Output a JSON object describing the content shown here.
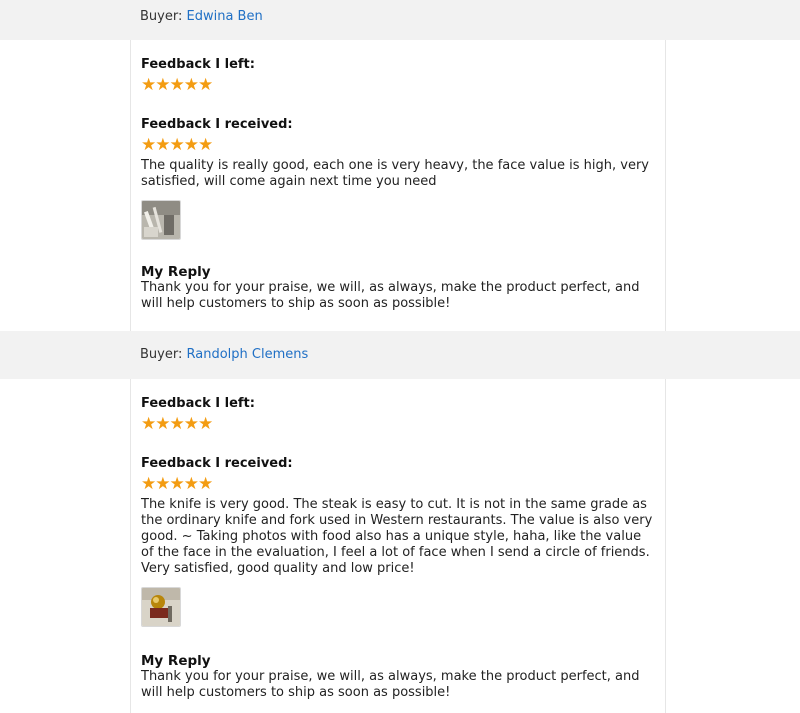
{
  "reviews": [
    {
      "buyer_label": "Buyer:",
      "buyer_name": "Edwina Ben",
      "feedback_left_label": "Feedback I left:",
      "feedback_left_stars": "★★★★★",
      "feedback_left_rating": 5,
      "feedback_received_label": "Feedback I received:",
      "feedback_received_stars": "★★★★★",
      "feedback_received_rating": 5,
      "comment": "The quality is really good, each one is very heavy, the face value is high, very satisfied, will come again next time you need",
      "photo_icon": "review-photo",
      "reply_label": "My Reply",
      "reply_text": "Thank you for your praise, we will, as always, make the product perfect, and will help customers to ship as soon as possible!"
    },
    {
      "buyer_label": "Buyer:",
      "buyer_name": "Randolph Clemens",
      "feedback_left_label": "Feedback I left:",
      "feedback_left_stars": "★★★★★",
      "feedback_left_rating": 5,
      "feedback_received_label": "Feedback I received:",
      "feedback_received_stars": "★★★★★",
      "feedback_received_rating": 5,
      "comment": "The knife is very good. The steak is easy to cut. It is not in the same grade as the ordinary knife and fork used in Western restaurants. The value is also very good. ~ Taking photos with food also has a unique style, haha, like the value of the face in the evaluation, I feel a lot of face when I send a circle of friends. Very satisfied, good quality and low price!",
      "photo_icon": "review-photo",
      "reply_label": "My Reply",
      "reply_text": "Thank you for your praise, we will, as always, make the product perfect, and will help customers to ship as soon as possible!"
    }
  ],
  "colors": {
    "star": "#f39c12",
    "link": "#1f6fc5",
    "buyer_bar_bg": "#f2f2f2"
  }
}
